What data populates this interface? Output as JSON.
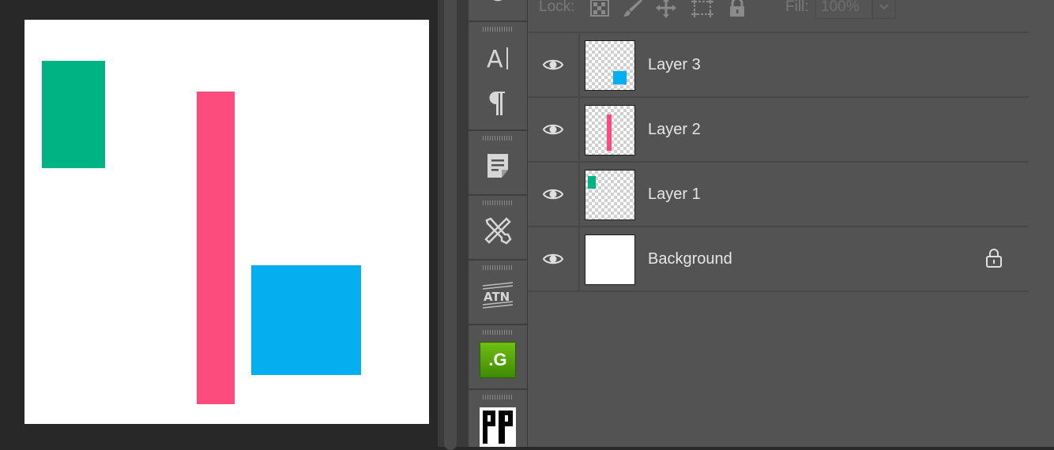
{
  "canvas": {
    "background": "#ffffff",
    "shapes": [
      {
        "name": "green-rectangle",
        "color": "#00b383"
      },
      {
        "name": "pink-rectangle",
        "color": "#fc4c7d"
      },
      {
        "name": "blue-square",
        "color": "#04aeef"
      }
    ]
  },
  "strip": {
    "icons": [
      "clock-icon",
      "character-icon",
      "paragraph-icon",
      "notes-icon",
      "tools-icon",
      "atn-icon",
      "g-plugin-icon",
      "pp-plugin-icon"
    ],
    "atn_label": "ATN",
    "g_label": ".G"
  },
  "lock_bar": {
    "lock_label": "Lock:",
    "fill_label": "Fill:",
    "fill_value": "100%"
  },
  "layers": [
    {
      "name": "Layer 3",
      "visible": true,
      "thumb_color": "#04aeef",
      "locked": false
    },
    {
      "name": "Layer 2",
      "visible": true,
      "thumb_color": "#fc4c7d",
      "locked": false
    },
    {
      "name": "Layer 1",
      "visible": true,
      "thumb_color": "#00b383",
      "locked": false
    },
    {
      "name": "Background",
      "visible": true,
      "thumb_color": "#ffffff",
      "locked": true
    }
  ]
}
